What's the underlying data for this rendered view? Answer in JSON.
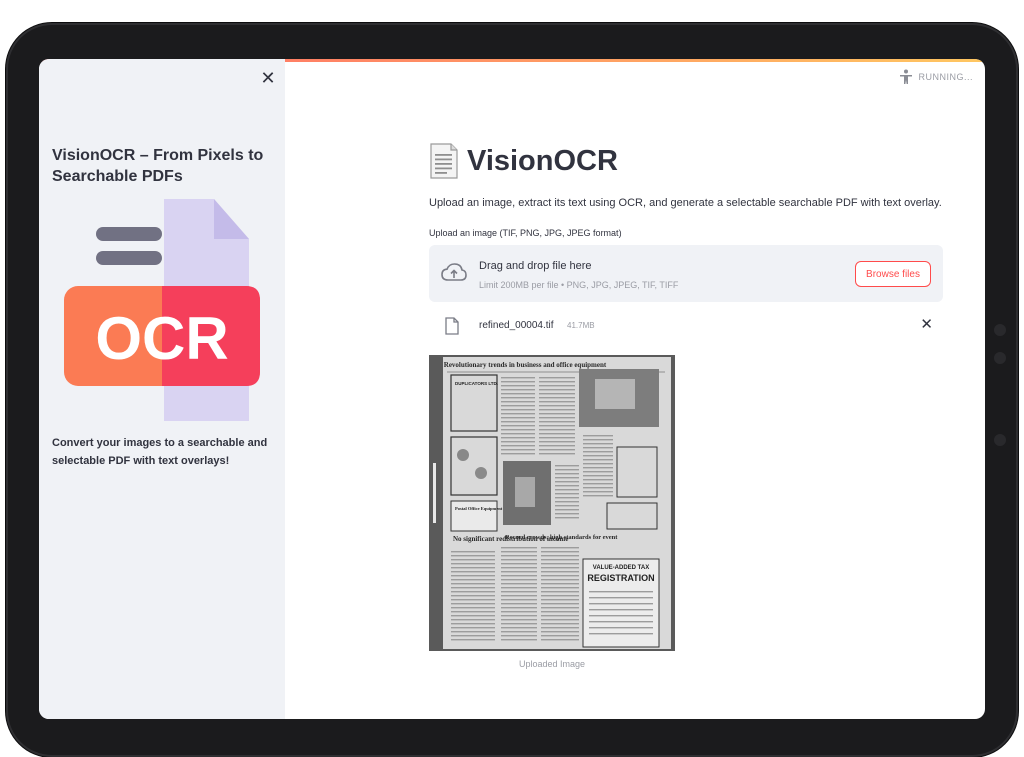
{
  "status": {
    "running_label": "RUNNING..."
  },
  "sidebar": {
    "title": "VisionOCR – From Pixels to Searchable PDFs",
    "logo_text": "OCR",
    "description": "Convert your images to a searchable and selectable PDF with text overlays!"
  },
  "main": {
    "title": "VisionOCR",
    "subtitle": "Upload an image, extract its text using OCR, and generate a selectable searchable PDF with text overlay.",
    "upload_label": "Upload an image (TIF, PNG, JPG, JPEG format)",
    "dropzone": {
      "main_text": "Drag and drop file here",
      "sub_text": "Limit 200MB per file • PNG, JPG, JPEG, TIF, TIFF",
      "browse_label": "Browse files"
    },
    "file": {
      "name": "refined_00004.tif",
      "size": "41.7MB"
    },
    "image_caption": "Uploaded Image",
    "newspaper": {
      "headline1": "Revolutionary trends in business and office equipment",
      "headline2": "No significant redistribution of income",
      "headline3": "Record crowds, high standards for event",
      "ad1": "VALUE-ADDED TAX",
      "ad2": "REGISTRATION",
      "box1": "DUPLICATORS LTD.",
      "box2": "Postal Office Equipment"
    }
  },
  "colors": {
    "accent": "#ff4b4b",
    "sidebar_bg": "#f0f2f6",
    "text": "#31333f",
    "muted": "#9a9ca4",
    "logo_red": "#f53f5b",
    "logo_orange": "#fb7b54",
    "logo_lavender": "#d9d3f2"
  }
}
